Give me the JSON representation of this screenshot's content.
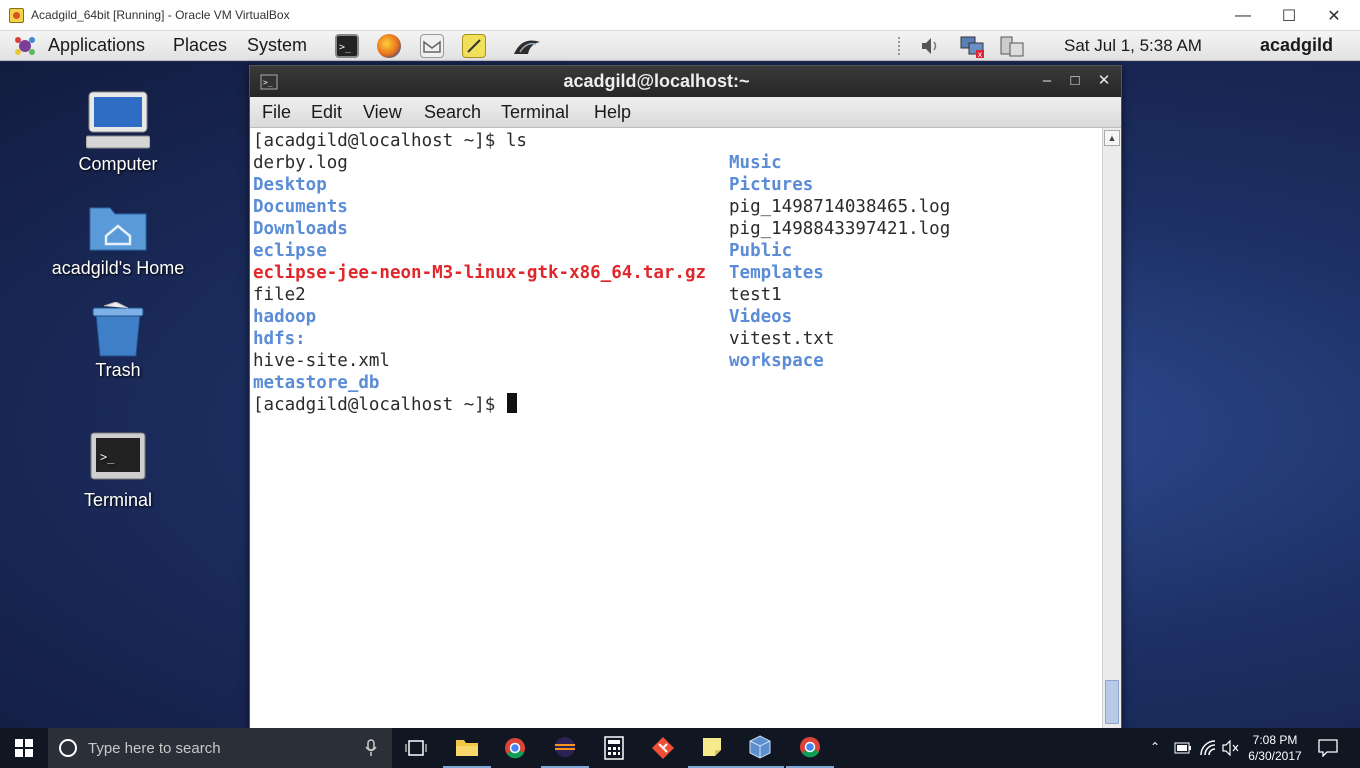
{
  "host_window": {
    "title": "Acadgild_64bit [Running] - Oracle VM VirtualBox",
    "minimize": "—",
    "maximize": "☐",
    "close": "✕"
  },
  "gnome_panel": {
    "menus": [
      "Applications",
      "Places",
      "System"
    ],
    "launchers": [
      "terminal-icon",
      "firefox-icon",
      "mail-icon",
      "notes-icon",
      "wireshark-icon"
    ],
    "tray_icons": [
      "volume-icon",
      "network-icon",
      "display-icon"
    ],
    "clock": "Sat Jul  1,  5:38 AM",
    "user": "acadgild"
  },
  "desktop": {
    "icons": [
      {
        "label": "Computer",
        "icon": "computer-icon"
      },
      {
        "label": "acadgild's Home",
        "icon": "home-folder-icon"
      },
      {
        "label": "Trash",
        "icon": "trash-icon"
      },
      {
        "label": "Terminal",
        "icon": "terminal-icon"
      }
    ]
  },
  "terminal": {
    "title": "acadgild@localhost:~",
    "buttons": {
      "minimize": "–",
      "maximize": "□",
      "close": "✕"
    },
    "menu": [
      "File",
      "Edit",
      "View",
      "Search",
      "Terminal",
      "Help"
    ],
    "prompt_cmd": "[acadgild@localhost ~]$ ls",
    "prompt_current": "[acadgild@localhost ~]$ ",
    "left_column": [
      {
        "text": "derby.log",
        "type": "file"
      },
      {
        "text": "Desktop",
        "type": "dir"
      },
      {
        "text": "Documents",
        "type": "dir"
      },
      {
        "text": "Downloads",
        "type": "dir"
      },
      {
        "text": "eclipse",
        "type": "dir"
      },
      {
        "text": "eclipse-jee-neon-M3-linux-gtk-x86_64.tar.gz",
        "type": "archive"
      },
      {
        "text": "file2",
        "type": "file"
      },
      {
        "text": "hadoop",
        "type": "dir"
      },
      {
        "text": "hdfs:",
        "type": "dir"
      },
      {
        "text": "hive-site.xml",
        "type": "file"
      },
      {
        "text": "metastore_db",
        "type": "dir"
      }
    ],
    "right_column": [
      {
        "text": "Music",
        "type": "dir"
      },
      {
        "text": "Pictures",
        "type": "dir"
      },
      {
        "text": "pig_1498714038465.log",
        "type": "file"
      },
      {
        "text": "pig_1498843397421.log",
        "type": "file"
      },
      {
        "text": "Public",
        "type": "dir"
      },
      {
        "text": "Templates",
        "type": "dir"
      },
      {
        "text": "test1",
        "type": "file"
      },
      {
        "text": "Videos",
        "type": "dir"
      },
      {
        "text": "vitest.txt",
        "type": "file"
      },
      {
        "text": "workspace",
        "type": "dir"
      }
    ],
    "colors": {
      "dir": "#5b8cd6",
      "archive": "#e0282c",
      "file": "#2b2b2b"
    }
  },
  "taskbar": {
    "search_placeholder": "Type here to search",
    "apps": [
      "task-view-icon",
      "file-explorer-icon",
      "chrome-icon",
      "eclipse-icon",
      "calculator-icon",
      "git-icon",
      "sticky-notes-icon",
      "virtualbox-icon",
      "chrome-icon"
    ],
    "time": "7:08 PM",
    "date": "6/30/2017"
  }
}
